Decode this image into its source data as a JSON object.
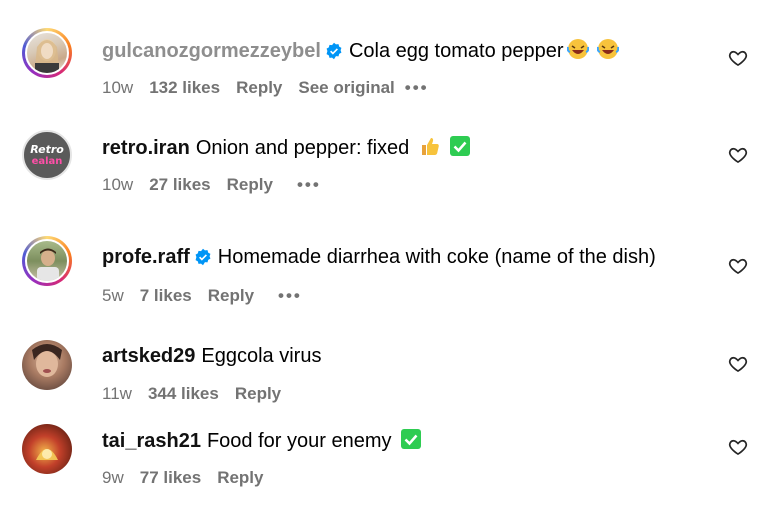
{
  "comments": [
    {
      "username": "gulcanozgormezzeybel",
      "verified": true,
      "text": "Cola egg tomato pepper",
      "emojis": [
        "laughing-crying",
        "laughing-crying"
      ],
      "age": "10w",
      "likes": "132 likes",
      "reply": "Reply",
      "see_original": "See original",
      "more": "•••"
    },
    {
      "username": "retro.iran",
      "verified": false,
      "text": "Onion and pepper: fixed",
      "emojis": [
        "thumbs-up",
        "check-box"
      ],
      "avatar_text_top": "Retro",
      "avatar_text_bottom": "ealan",
      "age": "10w",
      "likes": "27 likes",
      "reply": "Reply",
      "more": "•••"
    },
    {
      "username": "profe.raff",
      "verified": true,
      "text": "Homemade diarrhea with coke (name of the dish)",
      "age": "5w",
      "likes": "7 likes",
      "reply": "Reply",
      "more": "•••"
    },
    {
      "username": "artsked29",
      "verified": false,
      "text": "Eggcola virus",
      "age": "11w",
      "likes": "344 likes",
      "reply": "Reply"
    },
    {
      "username": "tai_rash21",
      "verified": false,
      "text": "Food for your enemy",
      "emojis": [
        "check-box"
      ],
      "age": "9w",
      "likes": "77 likes",
      "reply": "Reply"
    }
  ],
  "colors": {
    "verified": "#0095f6",
    "muted_text": "#737373",
    "check_box": "#2ecc52"
  }
}
